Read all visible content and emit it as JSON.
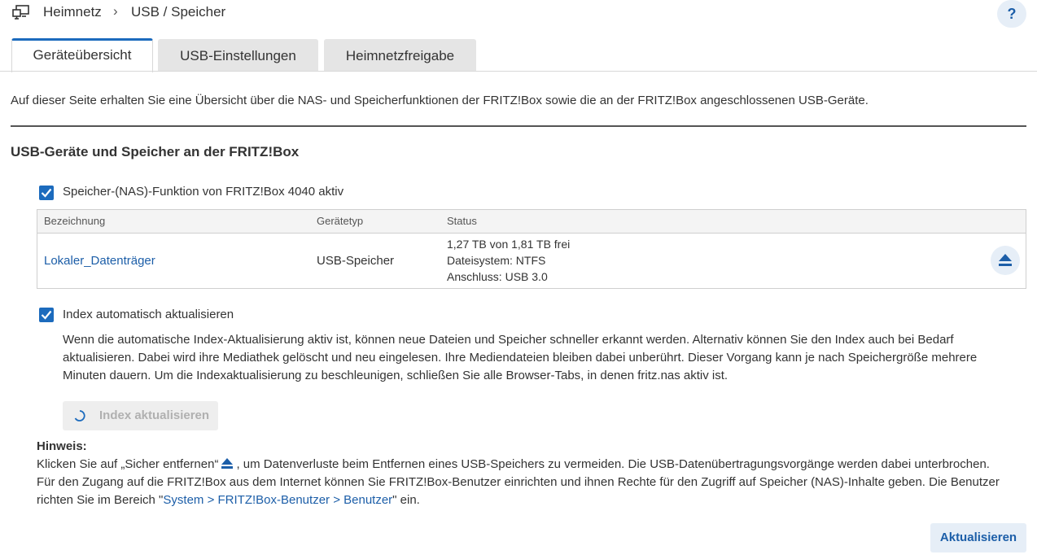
{
  "breadcrumb": {
    "home": "Heimnetz",
    "separator": "›",
    "current": "USB / Speicher"
  },
  "help": {
    "label": "?"
  },
  "tabs": [
    {
      "label": "Geräteübersicht"
    },
    {
      "label": "USB-Einstellungen"
    },
    {
      "label": "Heimnetzfreigabe"
    }
  ],
  "intro": "Auf dieser Seite erhalten Sie eine Übersicht über die NAS- und Speicherfunktionen der FRITZ!Box sowie die an der FRITZ!Box angeschlossenen USB-Geräte.",
  "section_title": "USB-Geräte und Speicher an der FRITZ!Box",
  "nas_checkbox": {
    "label": "Speicher-(NAS)-Funktion von FRITZ!Box 4040 aktiv",
    "checked": true
  },
  "table": {
    "headers": [
      "Bezeichnung",
      "Gerätetyp",
      "Status"
    ],
    "rows": [
      {
        "name": "Lokaler_Datenträger",
        "type": "USB-Speicher",
        "status": [
          "1,27 TB von 1,81 TB frei",
          "Dateisystem: NTFS",
          "Anschluss: USB 3.0"
        ]
      }
    ]
  },
  "index_checkbox": {
    "label": "Index automatisch aktualisieren",
    "checked": true
  },
  "index_description": "Wenn die automatische Index-Aktualisierung aktiv ist, können neue Dateien und Speicher schneller erkannt werden. Alternativ können Sie den Index auch bei Bedarf aktualisieren. Dabei wird ihre Mediathek gelöscht und neu eingelesen. Ihre Mediendateien bleiben dabei unberührt. Dieser Vorgang kann je nach Speichergröße mehrere Minuten dauern. Um die Indexaktualisierung zu beschleunigen, schließen Sie alle Browser-Tabs, in denen fritz.nas aktiv ist.",
  "index_button": {
    "label": "Index aktualisieren"
  },
  "hint": {
    "title": "Hinweis:",
    "line1_before": "Klicken Sie auf „Sicher entfernen“",
    "line1_after": ", um Datenverluste beim Entfernen eines USB-Speichers zu vermeiden. Die USB-Datenübertragungsvorgänge werden dabei unterbrochen.",
    "line2_before": "Für den Zugang auf die FRITZ!Box aus dem Internet können Sie FRITZ!Box-Benutzer einrichten und ihnen Rechte für den Zugriff auf Speicher (NAS)-Inhalte geben. Die Benutzer richten Sie im Bereich \"",
    "link": "System > FRITZ!Box-Benutzer > Benutzer",
    "line2_after": "\" ein."
  },
  "update_button": {
    "label": "Aktualisieren"
  },
  "colors": {
    "accent": "#1c6bbd",
    "link": "#1c5ea8",
    "button_bg": "#e6eef7"
  }
}
